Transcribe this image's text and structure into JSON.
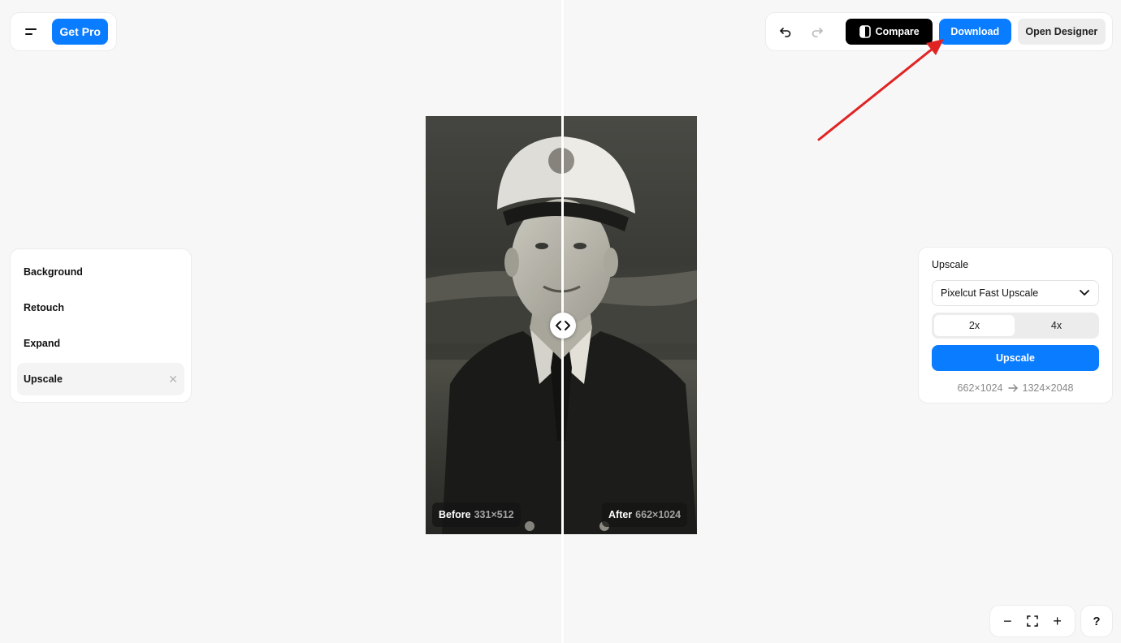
{
  "header_left": {
    "get_pro_label": "Get Pro"
  },
  "toolbar": {
    "undo_icon": "undo-icon",
    "redo_icon": "redo-icon",
    "compare_label": "Compare",
    "download_label": "Download",
    "open_designer_label": "Open Designer"
  },
  "canvas": {
    "before_label": "Before",
    "before_size": "331×512",
    "after_label": "After",
    "after_size": "662×1024"
  },
  "tools": {
    "items": [
      {
        "label": "Background"
      },
      {
        "label": "Retouch"
      },
      {
        "label": "Expand"
      },
      {
        "label": "Upscale"
      }
    ]
  },
  "upscale_panel": {
    "title": "Upscale",
    "model_selected": "Pixelcut Fast Upscale",
    "scale_options": [
      "2x",
      "4x"
    ],
    "scale_selected": "2x",
    "upscale_button": "Upscale",
    "from_size": "662×1024",
    "to_size": "1324×2048"
  },
  "zoom": {
    "zoom_out": "−",
    "zoom_in": "+"
  },
  "help_label": "?",
  "colors": {
    "accent": "#0a7cff",
    "annotation_arrow": "#e02424"
  }
}
